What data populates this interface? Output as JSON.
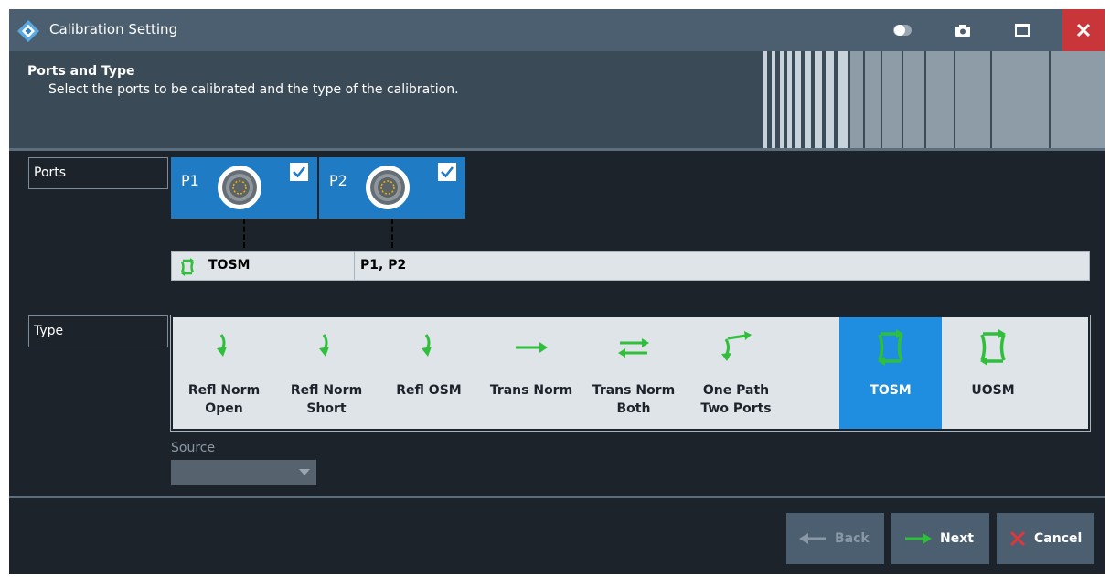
{
  "window": {
    "title": "Calibration Setting",
    "icons": [
      "logo-icon",
      "toggle-icon",
      "camera-icon",
      "maximize-icon",
      "close-icon"
    ]
  },
  "header": {
    "title": "Ports and Type",
    "subtitle": "Select the ports to be calibrated and the type of the calibration."
  },
  "ports_section": {
    "label": "Ports",
    "ports": [
      {
        "name": "P1",
        "checked": true
      },
      {
        "name": "P2",
        "checked": true
      }
    ],
    "calibration_row": {
      "type": "TOSM",
      "ports": "P1, P2"
    }
  },
  "type_section": {
    "label": "Type",
    "items": [
      {
        "label": "Refl Norm\nOpen",
        "icon": "refl-norm-open-icon",
        "selected": false
      },
      {
        "label": "Refl Norm\nShort",
        "icon": "refl-norm-short-icon",
        "selected": false
      },
      {
        "label": "Refl OSM",
        "icon": "refl-osm-icon",
        "selected": false
      },
      {
        "label": "Trans Norm",
        "icon": "trans-norm-icon",
        "selected": false
      },
      {
        "label": "Trans Norm\nBoth",
        "icon": "trans-norm-both-icon",
        "selected": false
      },
      {
        "label": "One Path\nTwo Ports",
        "icon": "one-path-two-ports-icon",
        "selected": false
      },
      {
        "label": "TOSM",
        "icon": "tosm-icon",
        "selected": true
      },
      {
        "label": "UOSM",
        "icon": "uosm-icon",
        "selected": false
      }
    ]
  },
  "source": {
    "label": "Source",
    "value": ""
  },
  "buttons": {
    "back": "Back",
    "next": "Next",
    "cancel": "Cancel"
  },
  "colors": {
    "titlebar": "#4c5f70",
    "header": "#3b4a57",
    "background": "#1c232b",
    "port": "#1f7bc3",
    "selected": "#1f8ee0",
    "green": "#2fbf3b",
    "close": "#c8363a"
  }
}
